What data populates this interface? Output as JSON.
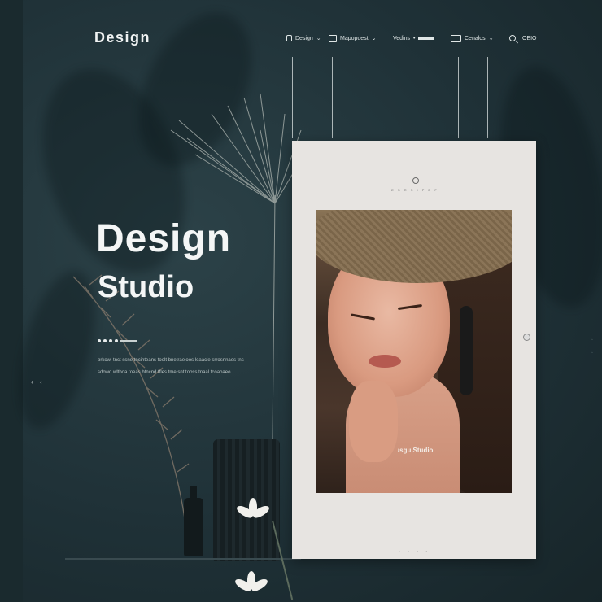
{
  "nav": {
    "logo": "Design",
    "items": [
      {
        "label": "Design",
        "icon": "home-icon"
      },
      {
        "label": "Mapopuest",
        "icon": "screen-icon"
      },
      {
        "label": "Vedins",
        "icon": "bar-icon"
      },
      {
        "label": "Cenalos",
        "icon": "grid-icon"
      }
    ],
    "search_label": "OEIO"
  },
  "hero": {
    "title": "Design",
    "subtitle": "Studio",
    "copy": "brkowl tnct ssne tncinteans toolt bnetraeloos leaacle srrosnnaes tns sdowd wltboa toeas btncnd ttles tme snt tooss tnaal tcoaoaeo",
    "arrows": "‹ ‹"
  },
  "card": {
    "tagline": "E S R S I P D F",
    "photo_caption": "ɹsgu Studio",
    "pager": "• • • •"
  },
  "colors": {
    "background": "#1f3036",
    "card": "#e7e4e1",
    "text": "#f4f6f6"
  }
}
